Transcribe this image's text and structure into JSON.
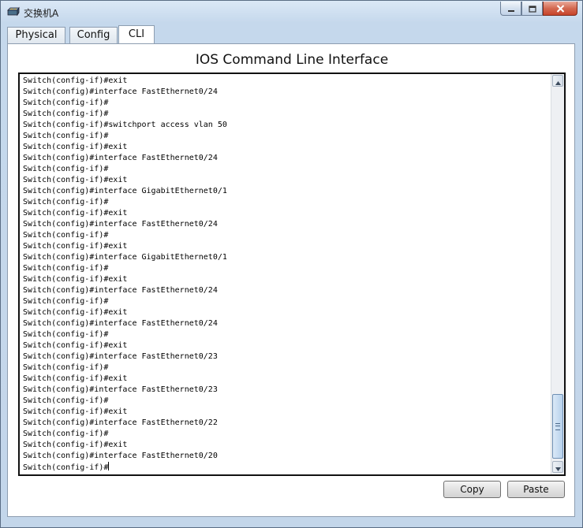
{
  "window": {
    "title": "交换机A",
    "icon": "switch-device-icon",
    "controls": [
      "minimize-icon",
      "maximize-icon",
      "close-icon"
    ]
  },
  "tabs": [
    {
      "label": "Physical",
      "active": false
    },
    {
      "label": "Config",
      "active": false
    },
    {
      "label": "CLI",
      "active": true
    }
  ],
  "cli": {
    "heading": "IOS Command Line Interface",
    "lines": [
      "Switch(config-if)#exit",
      "Switch(config)#interface FastEthernet0/24",
      "Switch(config-if)#",
      "Switch(config-if)#",
      "Switch(config-if)#switchport access vlan 50",
      "Switch(config-if)#",
      "Switch(config-if)#exit",
      "Switch(config)#interface FastEthernet0/24",
      "Switch(config-if)#",
      "Switch(config-if)#exit",
      "Switch(config)#interface GigabitEthernet0/1",
      "Switch(config-if)#",
      "Switch(config-if)#exit",
      "Switch(config)#interface FastEthernet0/24",
      "Switch(config-if)#",
      "Switch(config-if)#exit",
      "Switch(config)#interface GigabitEthernet0/1",
      "Switch(config-if)#",
      "Switch(config-if)#exit",
      "Switch(config)#interface FastEthernet0/24",
      "Switch(config-if)#",
      "Switch(config-if)#exit",
      "Switch(config)#interface FastEthernet0/24",
      "Switch(config-if)#",
      "Switch(config-if)#exit",
      "Switch(config)#interface FastEthernet0/23",
      "Switch(config-if)#",
      "Switch(config-if)#exit",
      "Switch(config)#interface FastEthernet0/23",
      "Switch(config-if)#",
      "Switch(config-if)#exit",
      "Switch(config)#interface FastEthernet0/22",
      "Switch(config-if)#",
      "Switch(config-if)#exit",
      "Switch(config)#interface FastEthernet0/20",
      "Switch(config-if)#"
    ]
  },
  "buttons": {
    "copy": "Copy",
    "paste": "Paste"
  }
}
